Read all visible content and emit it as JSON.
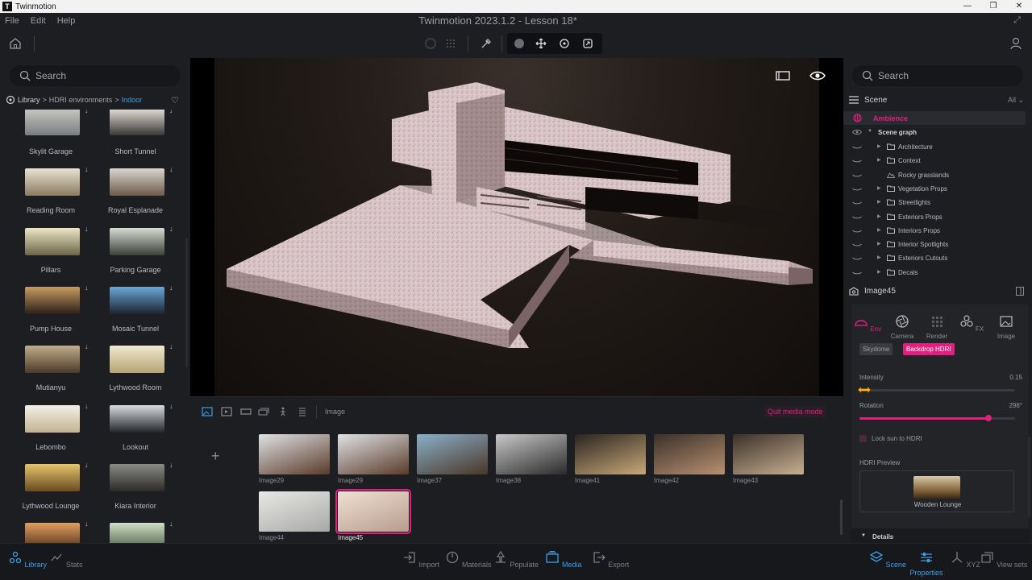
{
  "titlebar": {
    "app_name": "Twinmotion",
    "logo_letter": "T",
    "minimize": "—",
    "maximize": "❐",
    "close": "✕"
  },
  "menu": {
    "file": "File",
    "edit": "Edit",
    "help": "Help"
  },
  "window_title": "Twinmotion 2023.1.2 - Lesson 18*",
  "library": {
    "search_placeholder": "Search",
    "breadcrumb": {
      "root": "Library",
      "sep": ">",
      "level1": "HDRI environments",
      "level2": "Indoor"
    },
    "items": [
      {
        "label": "Skylit Garage",
        "col": 0,
        "row": 0,
        "colors": [
          "#c9c9c4",
          "#7a7d80"
        ]
      },
      {
        "label": "Short Tunnel",
        "col": 1,
        "row": 0,
        "colors": [
          "#e8e4dc",
          "#3a3836"
        ]
      },
      {
        "label": "Reading Room",
        "col": 0,
        "row": 1,
        "colors": [
          "#e9e2d2",
          "#8a7a60"
        ]
      },
      {
        "label": "Royal Esplanade",
        "col": 1,
        "row": 1,
        "colors": [
          "#d9d6cf",
          "#6d5a4a"
        ]
      },
      {
        "label": "Pillars",
        "col": 0,
        "row": 2,
        "colors": [
          "#ece6c4",
          "#6b6448"
        ]
      },
      {
        "label": "Parking Garage",
        "col": 1,
        "row": 2,
        "colors": [
          "#d6dcd2",
          "#3b4038"
        ]
      },
      {
        "label": "Pump House",
        "col": 0,
        "row": 3,
        "colors": [
          "#c89a62",
          "#2a2018"
        ]
      },
      {
        "label": "Mosaic Tunnel",
        "col": 1,
        "row": 3,
        "colors": [
          "#6aa6d6",
          "#1c2430"
        ]
      },
      {
        "label": "Mutianyu",
        "col": 0,
        "row": 4,
        "colors": [
          "#c2ad8c",
          "#4a3a2a"
        ]
      },
      {
        "label": "Lythwood Room",
        "col": 1,
        "row": 4,
        "colors": [
          "#f0ead0",
          "#b6a474"
        ]
      },
      {
        "label": "Lebombo",
        "col": 0,
        "row": 5,
        "colors": [
          "#f4f0e6",
          "#c2b292"
        ]
      },
      {
        "label": "Lookout",
        "col": 1,
        "row": 5,
        "colors": [
          "#d8dbe0",
          "#222428"
        ]
      },
      {
        "label": "Lythwood Lounge",
        "col": 0,
        "row": 6,
        "colors": [
          "#e4c46a",
          "#6a4a20"
        ]
      },
      {
        "label": "Kiara Interior",
        "col": 1,
        "row": 6,
        "colors": [
          "#8a8a86",
          "#2c2a28"
        ]
      },
      {
        "label": "",
        "col": 0,
        "row": 7,
        "colors": [
          "#e0a060",
          "#4a2a14"
        ]
      },
      {
        "label": "",
        "col": 1,
        "row": 7,
        "colors": [
          "#cfe0c8",
          "#4a5a44"
        ]
      }
    ]
  },
  "media_bar": {
    "type_label": "Image",
    "quit_label": "Quit media mode",
    "add_label": "+"
  },
  "media": [
    {
      "label": "Image29",
      "colors": [
        "#dfe2e4",
        "#5a3a2a"
      ],
      "selected": false,
      "col": 0,
      "row": 0
    },
    {
      "label": "Image29",
      "colors": [
        "#dfe2e4",
        "#5a3a2a"
      ],
      "selected": false,
      "col": 1,
      "row": 0
    },
    {
      "label": "Image37",
      "colors": [
        "#8ab0c8",
        "#4a3628"
      ],
      "selected": false,
      "col": 2,
      "row": 0
    },
    {
      "label": "Image38",
      "colors": [
        "#c8c8c8",
        "#2a2a2a"
      ],
      "selected": false,
      "col": 3,
      "row": 0
    },
    {
      "label": "Image41",
      "colors": [
        "#2a2420",
        "#c8a878"
      ],
      "selected": false,
      "col": 4,
      "row": 0
    },
    {
      "label": "Image42",
      "colors": [
        "#3a302a",
        "#b89070"
      ],
      "selected": false,
      "col": 5,
      "row": 0
    },
    {
      "label": "Image43",
      "colors": [
        "#3a302a",
        "#c8b090"
      ],
      "selected": false,
      "col": 6,
      "row": 0
    },
    {
      "label": "Image44",
      "colors": [
        "#e8e8e6",
        "#a8a8a6"
      ],
      "selected": false,
      "col": 0,
      "row": 1
    },
    {
      "label": "Image45",
      "colors": [
        "#efe0d4",
        "#b89c8c"
      ],
      "selected": true,
      "col": 1,
      "row": 1
    }
  ],
  "bottom_nav": {
    "library": "Library",
    "stats": "Stats",
    "import": "Import",
    "materials": "Materials",
    "populate": "Populate",
    "media": "Media",
    "export": "Export",
    "scene": "Scene",
    "properties": "Properties",
    "xyz": "XYZ",
    "view_sets": "View sets"
  },
  "scene_panel": {
    "search_placeholder": "Search",
    "title": "Scene",
    "filter": "All",
    "ambience": "Ambience",
    "scene_graph": "Scene graph",
    "items": [
      {
        "label": "Architecture",
        "folder": true,
        "expandable": true
      },
      {
        "label": "Context",
        "folder": true,
        "expandable": true
      },
      {
        "label": "Rocky grasslands",
        "folder": false,
        "expandable": false
      },
      {
        "label": "Vegetation Props",
        "folder": true,
        "expandable": true
      },
      {
        "label": "Streetlights",
        "folder": true,
        "expandable": true
      },
      {
        "label": "Exteriors Props",
        "folder": true,
        "expandable": true
      },
      {
        "label": "Interiors Props",
        "folder": true,
        "expandable": true
      },
      {
        "label": "Interior Spotlights",
        "folder": true,
        "expandable": true
      },
      {
        "label": "Exteriors Cutouts",
        "folder": true,
        "expandable": true
      },
      {
        "label": "Decals",
        "folder": true,
        "expandable": true
      }
    ]
  },
  "properties": {
    "title": "Image45",
    "tabs": [
      "Env",
      "Camera",
      "Render",
      "FX",
      "Image"
    ],
    "subtabs": {
      "skydome": "Skydome",
      "backdrop": "Backdrop HDRI"
    },
    "intensity": {
      "label": "Intensity",
      "value": "0.15",
      "fraction": 0.03
    },
    "rotation": {
      "label": "Rotation",
      "value": "298°",
      "fraction": 0.83
    },
    "lock_sun": "Lock sun to HDRI",
    "hdri_preview_label": "HDRI Preview",
    "hdri_name": "Wooden Lounge",
    "details": "Details"
  },
  "colors": {
    "accent": "#e0207f",
    "blue": "#3ca0e8",
    "bg": "#1d1e22"
  }
}
